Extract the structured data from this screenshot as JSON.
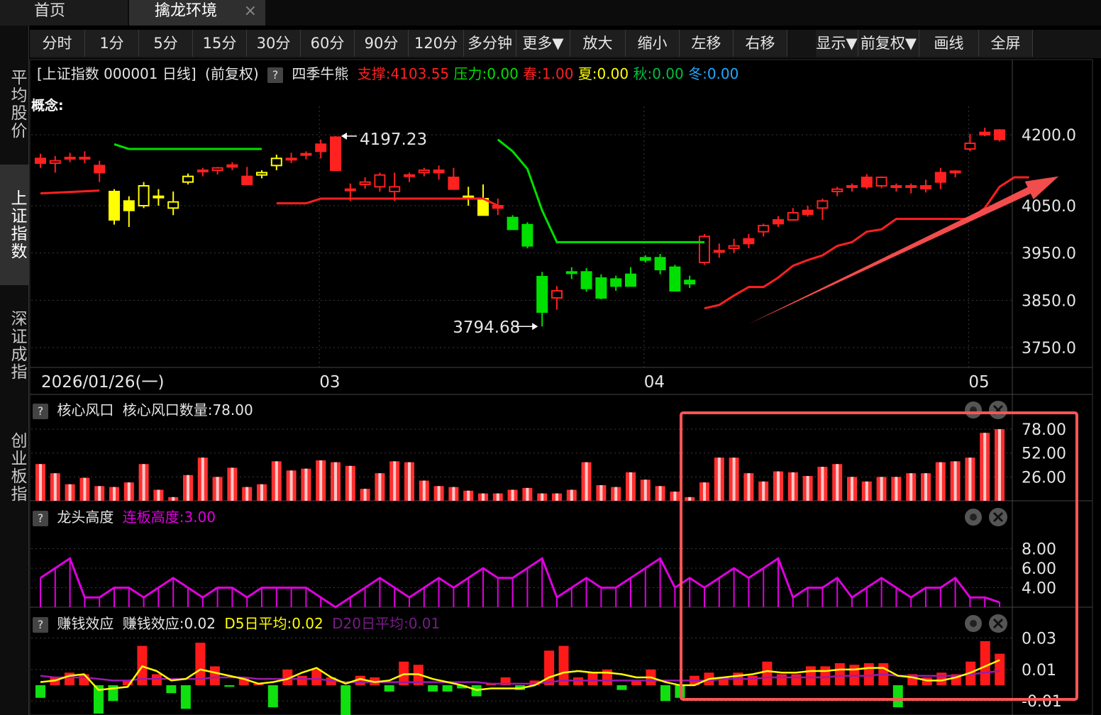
{
  "tabs": [
    {
      "label": "首页"
    },
    {
      "label": "擒龙环境",
      "close": "×"
    }
  ],
  "sidebar": [
    {
      "label": "平均股价"
    },
    {
      "label": "上证指数"
    },
    {
      "label": "深证成指"
    },
    {
      "label": "创业板指"
    }
  ],
  "toolbar": [
    "分时",
    "1分",
    "5分",
    "15分",
    "30分",
    "60分",
    "90分",
    "120分",
    "多分钟",
    "更多▼",
    "放大",
    "缩小",
    "左移",
    "右移",
    "显示▼",
    "前复权▼",
    "画线",
    "全屏"
  ],
  "info": {
    "title": "[上证指数 000001 日线]",
    "adjust": "(前复权)",
    "help": "?",
    "indicator": "四季牛熊",
    "support": "支撑:4103.55",
    "pressure": "压力:0.00",
    "spring": "春:1.00",
    "summer": "夏:0.00",
    "autumn": "秋:0.00",
    "winter": "冬:0.00"
  },
  "concept": "概念:",
  "colors": {
    "red": "#ff2020",
    "green": "#00e000",
    "yellow": "#ffff00",
    "magenta": "#e000e0",
    "purple": "#9b1bb0",
    "cyan": "#1ea8ff",
    "grid": "#3a3a3a",
    "highlight": "#ff5555"
  },
  "panels": {
    "fengkou": {
      "help": "?",
      "name": "核心风口",
      "value": "核心风口数量:78.00"
    },
    "longtou": {
      "help": "?",
      "name": "龙头高度",
      "value": "连板高度:3.00"
    },
    "zhuanqian": {
      "help": "?",
      "name": "赚钱效应",
      "value": "赚钱效应:0.02",
      "d5": "D5日平均:0.02",
      "d20": "D20日平均:0.01"
    }
  },
  "chart_data": [
    {
      "type": "candlestick",
      "ylim": [
        3720,
        4260
      ],
      "yticks": [
        "4200.0",
        "4050.0",
        "3950.0",
        "3850.0",
        "3750.0"
      ],
      "ytick_values": [
        4200,
        4050,
        3950,
        3850,
        3750
      ],
      "xticks": [
        {
          "label": "2026/01/26(一)",
          "i": 0
        },
        {
          "label": "03",
          "i": 19
        },
        {
          "label": "04",
          "i": 41
        },
        {
          "label": "05",
          "i": 63
        }
      ],
      "annotations": [
        {
          "label": "4197.23",
          "i": 20,
          "value": 4197.23
        },
        {
          "label": "3794.68",
          "i": 34,
          "value": 3794.68
        }
      ],
      "ohlc": [
        [
          4150,
          4160,
          4130,
          4140
        ],
        [
          4140,
          4155,
          4120,
          4145
        ],
        [
          4150,
          4162,
          4142,
          4152
        ],
        [
          4152,
          4165,
          4140,
          4152
        ],
        [
          4135,
          4145,
          4100,
          4120
        ],
        [
          4080,
          4085,
          4010,
          4020
        ],
        [
          4060,
          4070,
          4005,
          4040
        ],
        [
          4050,
          4100,
          4045,
          4092
        ],
        [
          4070,
          4085,
          4050,
          4070
        ],
        [
          4045,
          4080,
          4030,
          4058
        ],
        [
          4100,
          4118,
          4095,
          4112
        ],
        [
          4125,
          4130,
          4112,
          4125
        ],
        [
          4125,
          4132,
          4116,
          4130
        ],
        [
          4136,
          4142,
          4125,
          4132
        ],
        [
          4112,
          4132,
          4102,
          4095
        ],
        [
          4115,
          4125,
          4108,
          4120
        ],
        [
          4135,
          4158,
          4125,
          4150
        ],
        [
          4150,
          4162,
          4140,
          4150
        ],
        [
          4160,
          4165,
          4148,
          4160
        ],
        [
          4180,
          4190,
          4150,
          4165
        ],
        [
          4195,
          4197.23,
          4140,
          4125
        ],
        [
          4085,
          4097,
          4060,
          4085
        ],
        [
          4095,
          4110,
          4086,
          4100
        ],
        [
          4090,
          4120,
          4080,
          4115
        ],
        [
          4080,
          4120,
          4060,
          4090
        ],
        [
          4115,
          4120,
          4100,
          4112
        ],
        [
          4120,
          4130,
          4112,
          4125
        ],
        [
          4125,
          4135,
          4105,
          4120
        ],
        [
          4110,
          4130,
          4090,
          4085
        ],
        [
          4070,
          4090,
          4050,
          4068
        ],
        [
          4065,
          4095,
          4040,
          4030
        ],
        [
          4050,
          4065,
          4030,
          4045
        ],
        [
          4025,
          4030,
          4000,
          4000
        ],
        [
          4010,
          4015,
          3960,
          3965
        ],
        [
          3900,
          3910,
          3794.68,
          3825
        ],
        [
          3855,
          3880,
          3830,
          3870
        ],
        [
          3908,
          3920,
          3895,
          3910
        ],
        [
          3910,
          3918,
          3868,
          3875
        ],
        [
          3897,
          3905,
          3852,
          3855
        ],
        [
          3895,
          3902,
          3870,
          3880
        ],
        [
          3905,
          3920,
          3880,
          3880
        ],
        [
          3940,
          3945,
          3930,
          3935
        ],
        [
          3940,
          3948,
          3905,
          3915
        ],
        [
          3920,
          3925,
          3870,
          3870
        ],
        [
          3892,
          3902,
          3876,
          3885
        ],
        [
          3930,
          3990,
          3925,
          3985
        ],
        [
          3952,
          3970,
          3940,
          3955
        ],
        [
          3960,
          3980,
          3950,
          3965
        ],
        [
          3980,
          3990,
          3960,
          3970
        ],
        [
          3995,
          4012,
          3985,
          4008
        ],
        [
          4020,
          4028,
          4005,
          4012
        ],
        [
          4020,
          4045,
          4018,
          4035
        ],
        [
          4040,
          4050,
          4027,
          4032
        ],
        [
          4045,
          4065,
          4020,
          4060
        ],
        [
          4080,
          4090,
          4070,
          4085
        ],
        [
          4092,
          4097,
          4080,
          4090
        ],
        [
          4110,
          4117,
          4085,
          4090
        ],
        [
          4092,
          4112,
          4087,
          4110
        ],
        [
          4092,
          4097,
          4080,
          4090
        ],
        [
          4092,
          4097,
          4076,
          4090
        ],
        [
          4092,
          4105,
          4078,
          4086
        ],
        [
          4120,
          4130,
          4085,
          4100
        ],
        [
          4120,
          4125,
          4110,
          4123
        ],
        [
          4170,
          4202,
          4165,
          4182
        ],
        [
          4205,
          4215,
          4197,
          4200
        ],
        [
          4210,
          4212,
          4186,
          4190
        ]
      ],
      "resistance_green": [
        [
          5,
          4180
        ],
        [
          6,
          4170
        ],
        [
          15,
          4170
        ],
        [
          15,
          null
        ],
        [
          31,
          4190
        ],
        [
          32,
          4165
        ],
        [
          33,
          4128
        ],
        [
          34,
          4040
        ],
        [
          35,
          3973
        ],
        [
          45,
          3973
        ]
      ],
      "support_red": [
        [
          0,
          4076
        ],
        [
          4,
          4082
        ],
        [
          4,
          null
        ],
        [
          16,
          4055
        ],
        [
          18,
          4055
        ],
        [
          19,
          4065
        ],
        [
          30,
          4065
        ],
        [
          31,
          4050
        ],
        [
          31,
          null
        ],
        [
          45,
          3833
        ],
        [
          46,
          3840
        ],
        [
          47,
          3860
        ],
        [
          48,
          3878
        ],
        [
          49,
          3878
        ],
        [
          50,
          3898
        ],
        [
          51,
          3923
        ],
        [
          52,
          3935
        ],
        [
          53,
          3945
        ],
        [
          54,
          3965
        ],
        [
          55,
          3973
        ],
        [
          56,
          3995
        ],
        [
          57,
          4000
        ],
        [
          58,
          4022
        ],
        [
          59,
          4022
        ],
        [
          60,
          4022
        ],
        [
          61,
          4022
        ],
        [
          62,
          4022
        ],
        [
          63,
          4022
        ],
        [
          64,
          4045
        ],
        [
          65,
          4090
        ],
        [
          66,
          4110
        ],
        [
          67,
          4110
        ]
      ],
      "trend_arrow": {
        "from": [
          48,
          3800
        ],
        "to": [
          69,
          4112
        ]
      }
    },
    {
      "type": "bar",
      "name": "核心风口数量",
      "ylim": [
        0,
        85
      ],
      "yticks": [
        "78.00",
        "52.00",
        "26.00"
      ],
      "ytick_values": [
        78,
        52,
        26
      ],
      "values": [
        40,
        30,
        18,
        25,
        16,
        15,
        20,
        40,
        12,
        4,
        28,
        47,
        26,
        36,
        15,
        18,
        43,
        33,
        35,
        44,
        42,
        38,
        13,
        30,
        43,
        42,
        22,
        16,
        15,
        11,
        8,
        8,
        12,
        14,
        8,
        8,
        12,
        42,
        17,
        15,
        31,
        23,
        16,
        10,
        4,
        20,
        47,
        47,
        30,
        21,
        32,
        31,
        27,
        37,
        40,
        26,
        21,
        26,
        26,
        30,
        30,
        42,
        43,
        47,
        74,
        78
      ]
    },
    {
      "type": "line",
      "name": "连板高度",
      "ylim": [
        2.0,
        10.0
      ],
      "yticks": [
        "8.00",
        "6.00",
        "4.00"
      ],
      "ytick_values": [
        8,
        6,
        4
      ],
      "values": [
        5.0,
        6.0,
        7.0,
        3.0,
        3.0,
        4.0,
        4.0,
        3.0,
        4.0,
        5.0,
        4.0,
        3.0,
        4.0,
        4.0,
        3.0,
        4.0,
        4.0,
        4.0,
        4.0,
        3.0,
        2.0,
        3.0,
        4.0,
        5.0,
        4.0,
        3.0,
        4.0,
        5.0,
        4.0,
        5.0,
        6.0,
        5.0,
        5.0,
        6.0,
        7.0,
        3.0,
        4.0,
        5.0,
        4.0,
        4.0,
        5.0,
        6.0,
        7.0,
        4.0,
        5.0,
        4.0,
        5.0,
        6.0,
        5.0,
        6.0,
        7.0,
        3.0,
        4.0,
        4.0,
        5.0,
        3.0,
        4.0,
        5.0,
        4.0,
        3.0,
        4.0,
        4.0,
        5.0,
        3.0,
        3.0,
        2.5
      ]
    },
    {
      "type": "bar",
      "name": "赚钱效应",
      "ylim": [
        -0.018,
        0.032
      ],
      "yticks": [
        "0.03",
        "0.01",
        "-0.01"
      ],
      "ytick_values": [
        0.03,
        0.01,
        -0.01
      ],
      "values": [
        -0.008,
        0.005,
        0.008,
        0.007,
        -0.018,
        -0.01,
        0.003,
        0.025,
        0.007,
        -0.005,
        -0.015,
        0.027,
        0.012,
        -0.001,
        0.005,
        0.001,
        -0.014,
        0.01,
        0.006,
        0.01,
        0.005,
        -0.032,
        0.006,
        0.005,
        -0.004,
        0.015,
        0.013,
        -0.004,
        -0.004,
        -0.002,
        -0.007,
        0.001,
        0.005,
        -0.003,
        0.003,
        0.022,
        0.025,
        0.005,
        0.008,
        0.01,
        -0.003,
        0.003,
        0.01,
        -0.01,
        -0.008,
        0.006,
        0.008,
        0.005,
        0.008,
        0.006,
        0.015,
        0.007,
        0.007,
        0.012,
        0.012,
        0.014,
        0.013,
        0.014,
        0.014,
        -0.014,
        0.007,
        0.005,
        0.008,
        0.007,
        0.015,
        0.028,
        0.02
      ],
      "d5": [
        0.002,
        0.003,
        0.006,
        0.007,
        -0.003,
        -0.002,
        -0.001,
        0.012,
        0.009,
        0.003,
        0.004,
        0.01,
        0.008,
        0.006,
        0.004,
        0.001,
        0.002,
        0.004,
        0.008,
        0.011,
        0.005,
        0.001,
        0.004,
        0.002,
        0.003,
        0.007,
        0.007,
        0.004,
        0.002,
        0.0,
        -0.003,
        -0.002,
        -0.002,
        -0.002,
        0.0,
        0.005,
        0.008,
        0.009,
        0.008,
        0.008,
        0.007,
        0.005,
        0.005,
        0.002,
        0.0,
        0.0,
        0.004,
        0.005,
        0.006,
        0.007,
        0.009,
        0.008,
        0.008,
        0.009,
        0.009,
        0.01,
        0.01,
        0.011,
        0.011,
        0.006,
        0.005,
        0.003,
        0.003,
        0.005,
        0.008,
        0.012,
        0.016
      ],
      "d20": [
        0.006,
        0.005,
        0.005,
        0.005,
        0.004,
        0.003,
        0.003,
        0.004,
        0.004,
        0.004,
        0.004,
        0.004,
        0.005,
        0.005,
        0.005,
        0.004,
        0.004,
        0.004,
        0.004,
        0.004,
        0.003,
        0.002,
        0.002,
        0.002,
        0.002,
        0.002,
        0.002,
        0.002,
        0.002,
        0.002,
        0.002,
        0.001,
        0.001,
        0.001,
        0.001,
        0.002,
        0.003,
        0.003,
        0.003,
        0.003,
        0.003,
        0.003,
        0.003,
        0.003,
        0.003,
        0.003,
        0.003,
        0.004,
        0.004,
        0.004,
        0.005,
        0.005,
        0.005,
        0.005,
        0.005,
        0.006,
        0.006,
        0.006,
        0.007,
        0.006,
        0.006,
        0.006,
        0.006,
        0.006,
        0.007,
        0.008,
        0.009
      ]
    }
  ]
}
